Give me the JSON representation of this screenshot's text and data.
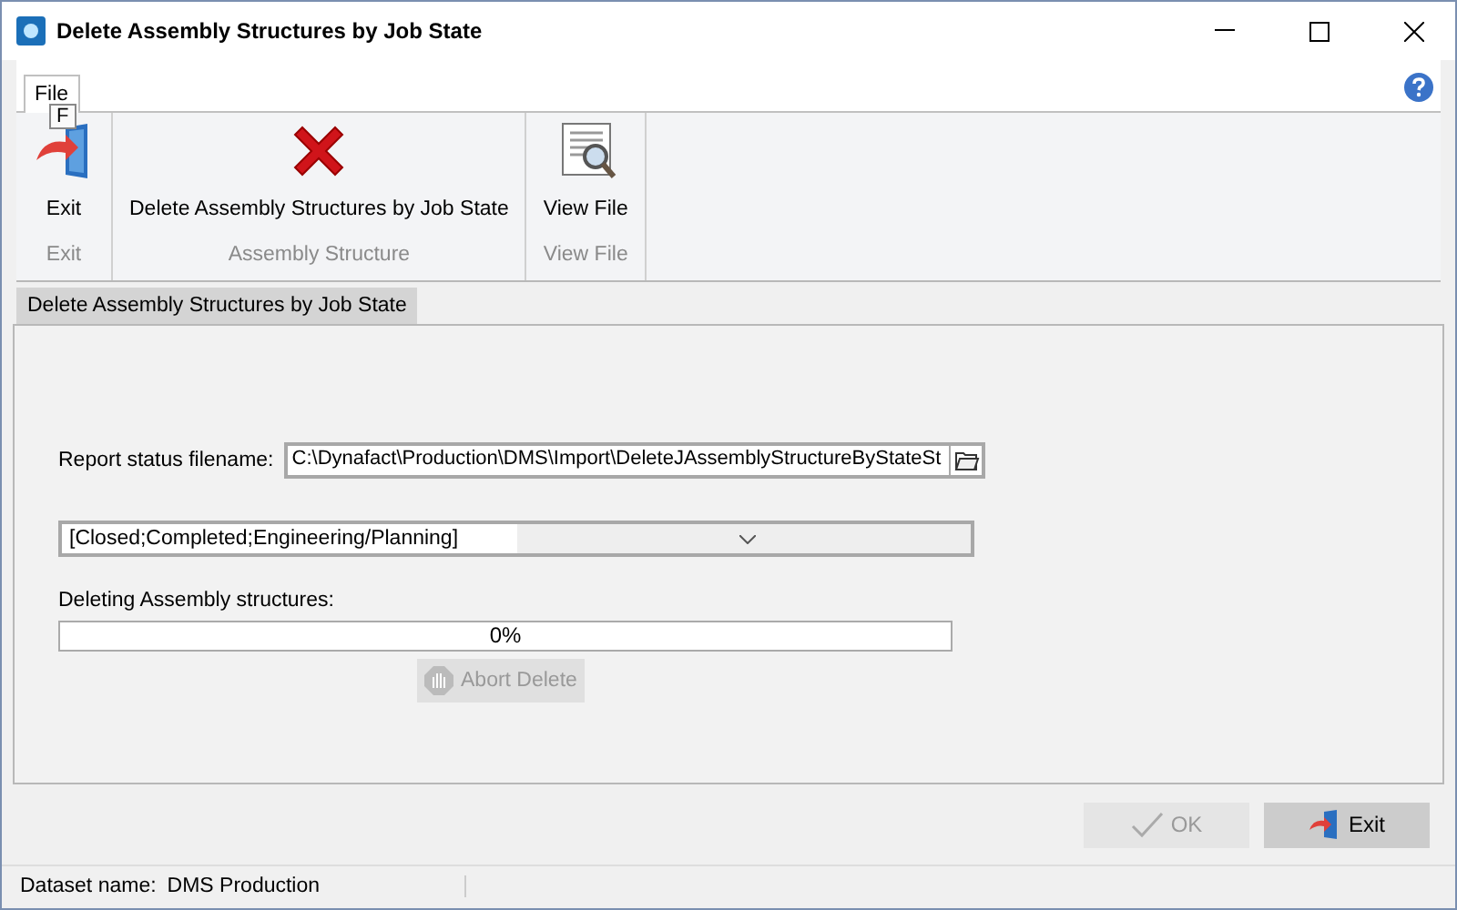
{
  "window": {
    "title": "Delete Assembly Structures by Job State"
  },
  "ribbon": {
    "tabs": [
      {
        "label": "File",
        "selected": true
      }
    ],
    "keytip": "F",
    "groups": [
      {
        "label": "Exit",
        "buttons": [
          {
            "label": "Exit",
            "kind": "exit"
          }
        ]
      },
      {
        "label": "Assembly Structure",
        "buttons": [
          {
            "label": "Delete Assembly Structures by Job State",
            "kind": "delete"
          }
        ]
      },
      {
        "label": "View File",
        "buttons": [
          {
            "label": "View File",
            "kind": "view"
          }
        ]
      }
    ]
  },
  "doc_tabs": [
    {
      "label": "Delete Assembly Structures by Job State",
      "selected": true
    }
  ],
  "form": {
    "filename_label": "Report status filename:",
    "filename_value": "C:\\Dynafact\\Production\\DMS\\Import\\DeleteJAssemblyStructureByStateSt",
    "states_value": "[Closed;Completed;Engineering/Planning]",
    "progress_label": "Deleting Assembly structures:",
    "progress": {
      "level": 0,
      "reading": "0%"
    },
    "abort_button": {
      "label": "Abort Delete",
      "disabled": true
    }
  },
  "buttons": [
    {
      "label": "OK",
      "kind": "ok",
      "disabled": true
    },
    {
      "label": "Exit",
      "kind": "exit",
      "disabled": false
    }
  ],
  "status_bar": {
    "label": "Dataset name:",
    "value": "DMS Production"
  }
}
